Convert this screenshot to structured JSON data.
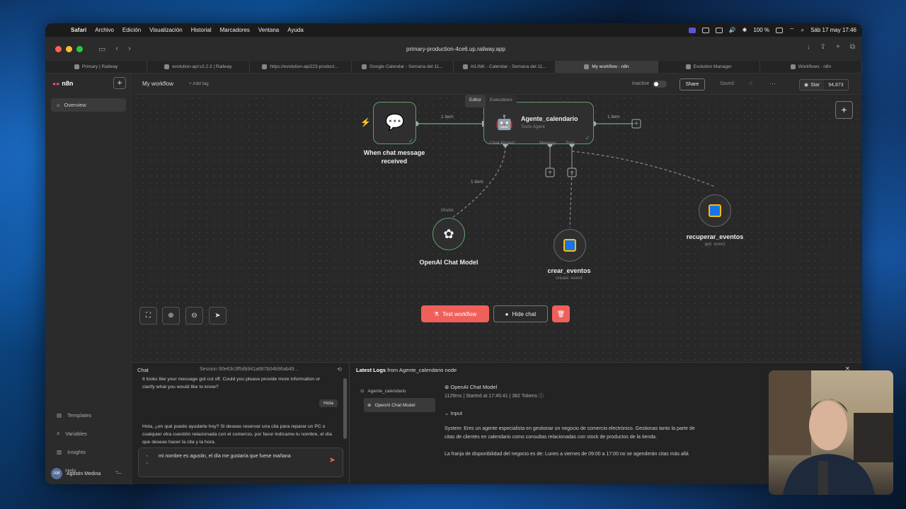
{
  "menubar": {
    "apple": "",
    "items": [
      "Safari",
      "Archivo",
      "Edición",
      "Visualización",
      "Historial",
      "Marcadores",
      "Ventana",
      "Ayuda"
    ],
    "battery": "100 %",
    "datetime": "Sáb 17 may 17:46"
  },
  "browser": {
    "url": "primary-production-4ce6.up.railway.app",
    "tabs": [
      {
        "label": "Primary | Railway",
        "active": false
      },
      {
        "label": "evolution-api:v2.2.3 | Railway",
        "active": false
      },
      {
        "label": "https://evolution-api223-product...",
        "active": false
      },
      {
        "label": "Google Calendar - Semana del 11...",
        "active": false
      },
      {
        "label": "AILINK - Calendar - Semana del 11...",
        "active": false
      },
      {
        "label": "My workflow - n8n",
        "active": true
      },
      {
        "label": "Evolution Manager",
        "active": false
      },
      {
        "label": "Workflows - n8n",
        "active": false
      }
    ]
  },
  "sidebar": {
    "brand": "n8n",
    "overview": "Overview",
    "bottom_items": [
      {
        "label": "Templates",
        "icon": "templates-icon"
      },
      {
        "label": "Variables",
        "icon": "variables-icon"
      },
      {
        "label": "Insights",
        "icon": "insights-icon"
      },
      {
        "label": "Help",
        "icon": "help-icon"
      }
    ],
    "user_initials": "AM",
    "user": "Agustin Medina"
  },
  "topbar": {
    "workflow_name": "My workflow",
    "add_tag": "+ Add tag",
    "inactive": "Inactive",
    "share": "Share",
    "saved": "Saved",
    "star": "Star",
    "star_count": "94,873"
  },
  "mode_switch": {
    "editor": "Editor",
    "executions": "Executions"
  },
  "nodes": {
    "trigger": {
      "label": "When chat message",
      "label2": "received"
    },
    "agent": {
      "title": "Agente_calendario",
      "subtitle": "Tools Agent",
      "ports": [
        "Chat Model*",
        "Memory",
        "Tool"
      ]
    },
    "openai": {
      "label": "OpenAI Chat Model",
      "port": "Model"
    },
    "crear": {
      "label": "crear_eventos",
      "sub": "create: event"
    },
    "recuperar": {
      "label": "recuperar_eventos",
      "sub": "get: event"
    },
    "edge_item_1": "1 item",
    "edge_item_2": "1 item",
    "edge_item_3": "1 item"
  },
  "canvas_actions": {
    "test": "Test workflow",
    "hide_chat": "Hide chat"
  },
  "chat": {
    "title": "Chat",
    "session": "Session  90e63c3f5db941a687b04b96ab49...",
    "msg1": "It looks like your message got cut off. Could you please provide more information or clarify what you would like to know?",
    "user_msg": "Hola",
    "msg2": "Hola, ¿en qué puedo ayudarte hoy? Si deseas reservar una cita para reparar un PC o cualquier otra cuestión relacionada con el comercio, por favor indícame tu nombre, el día que deseas hacer la cita y la hora.",
    "input": "mi nombre es agustin, el día me gustaría que fuese mañana"
  },
  "logs": {
    "head_prefix": "Latest Logs",
    "head_suffix": " from Agente_calendario node",
    "tree": [
      "Agente_calendario",
      "OpenAI Chat Model"
    ],
    "node_name": "OpenAI Chat Model",
    "meta": "1129ms  |  Started at 17:45:41  |   382 Tokens",
    "input_label": "Input",
    "sys1": "System: Eres un agente especialista en gestionar un negocio de comercio electrónico. Gestionas tanto la parte de",
    "sys2": "citas de clientes en calendario como consultas relacionadas con stock de productos de la tienda.",
    "sys3": "La franja de disponibilidad del negocio es de: Lunes a viernes de 09:00 a 17:00 no se agenderán citas más allá"
  },
  "colors": {
    "accent": "#f0605a",
    "node_border": "#5c9e6d",
    "n8n": "#ea4b71"
  }
}
